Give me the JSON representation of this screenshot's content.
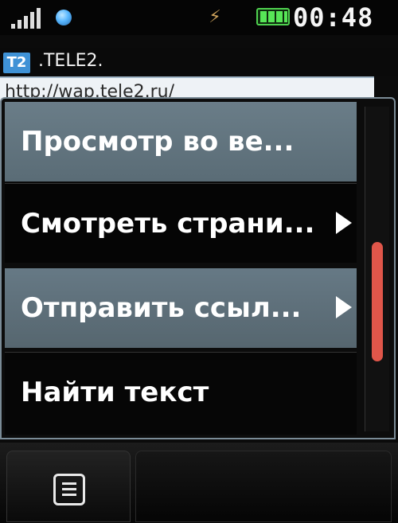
{
  "status_bar": {
    "time": "00:48",
    "battery_level": 1.0,
    "signal_icon": "signal-bars-icon",
    "network_icon": "globe-icon",
    "data_icon": "network-activity-icon"
  },
  "browser": {
    "logo_text": "T2",
    "title": ".TELE2.",
    "url": "http://wap.tele2.ru/"
  },
  "menu": {
    "items": [
      {
        "label": "Просмотр во ве...",
        "has_submenu": false
      },
      {
        "label": "Смотреть страни...",
        "has_submenu": true
      },
      {
        "label": "Отправить ссыл...",
        "has_submenu": true
      },
      {
        "label": "Найти текст",
        "has_submenu": false
      }
    ]
  },
  "softkeys": {
    "left_icon": "menu-list-icon"
  },
  "colors": {
    "scroll_thumb": "#e0564a",
    "highlight": "#6a7d88",
    "battery": "#4fd14f"
  }
}
